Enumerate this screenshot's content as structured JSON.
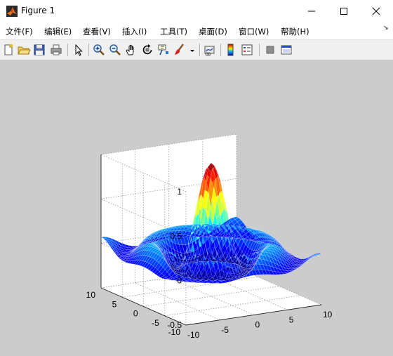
{
  "window": {
    "title": "Figure 1"
  },
  "menu": [
    {
      "label": "文件(F)"
    },
    {
      "label": "编辑(E)"
    },
    {
      "label": "查看(V)"
    },
    {
      "label": "插入(I)"
    },
    {
      "label": "工具(T)"
    },
    {
      "label": "桌面(D)"
    },
    {
      "label": "窗口(W)"
    },
    {
      "label": "帮助(H)"
    }
  ],
  "toolbar": [
    {
      "icon": "new-figure-icon"
    },
    {
      "icon": "open-file-icon"
    },
    {
      "icon": "save-icon"
    },
    {
      "icon": "print-icon"
    },
    {
      "icon": "edit-plot-arrow-icon"
    },
    {
      "icon": "zoom-in-icon"
    },
    {
      "icon": "zoom-out-icon"
    },
    {
      "icon": "pan-hand-icon"
    },
    {
      "icon": "rotate-3d-icon"
    },
    {
      "icon": "data-cursor-icon"
    },
    {
      "icon": "brush-icon"
    },
    {
      "icon": "link-plot-icon"
    },
    {
      "icon": "insert-colorbar-icon"
    },
    {
      "icon": "insert-legend-icon"
    },
    {
      "icon": "hide-plot-tools-icon"
    },
    {
      "icon": "show-plot-tools-icon"
    }
  ],
  "chart_data": {
    "type": "surface",
    "function": "z = sin(r)/r, r = sqrt(x^2 + y^2)",
    "colormap": "jet",
    "grid": true,
    "xlim": [
      -10,
      10
    ],
    "ylim": [
      -10,
      10
    ],
    "zlim": [
      -0.5,
      1
    ],
    "xticks": [
      "-10",
      "-5",
      "0",
      "5",
      "10"
    ],
    "yticks": [
      "-10",
      "-5",
      "0",
      "5",
      "10"
    ],
    "zticks": [
      "-0.5",
      "0",
      "0.5",
      "1"
    ],
    "peak": {
      "x": 0,
      "y": 0,
      "z": 1
    }
  }
}
